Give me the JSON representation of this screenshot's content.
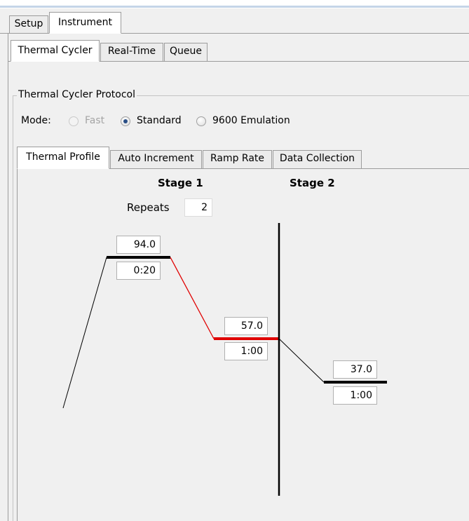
{
  "top_tabs": [
    {
      "label": "Setup",
      "active": false
    },
    {
      "label": "Instrument",
      "active": true
    }
  ],
  "sub_tabs": [
    {
      "label": "Thermal Cycler",
      "active": true
    },
    {
      "label": "Real-Time",
      "active": false
    },
    {
      "label": "Queue",
      "active": false
    }
  ],
  "protocol": {
    "group_title": "Thermal Cycler Protocol",
    "mode_label": "Mode:",
    "modes": [
      {
        "label": "Fast",
        "selected": false,
        "enabled": false
      },
      {
        "label": "Standard",
        "selected": true,
        "enabled": true
      },
      {
        "label": "9600 Emulation",
        "selected": false,
        "enabled": true
      }
    ]
  },
  "profile_tabs": [
    {
      "label": "Thermal Profile",
      "active": true
    },
    {
      "label": "Auto Increment",
      "active": false
    },
    {
      "label": "Ramp Rate",
      "active": false
    },
    {
      "label": "Data Collection",
      "active": false
    }
  ],
  "stages": [
    {
      "title": "Stage 1",
      "repeats_label": "Repeats",
      "repeats": "2",
      "steps": [
        {
          "temperature": "94.0",
          "time": "0:20"
        },
        {
          "temperature": "57.0",
          "time": "1:00"
        }
      ]
    },
    {
      "title": "Stage 2",
      "steps": [
        {
          "temperature": "37.0",
          "time": "1:00"
        }
      ]
    }
  ],
  "colors": {
    "hold_line": "#000000",
    "selected_ramp": "#e00000",
    "stage_divider": "#000000"
  }
}
